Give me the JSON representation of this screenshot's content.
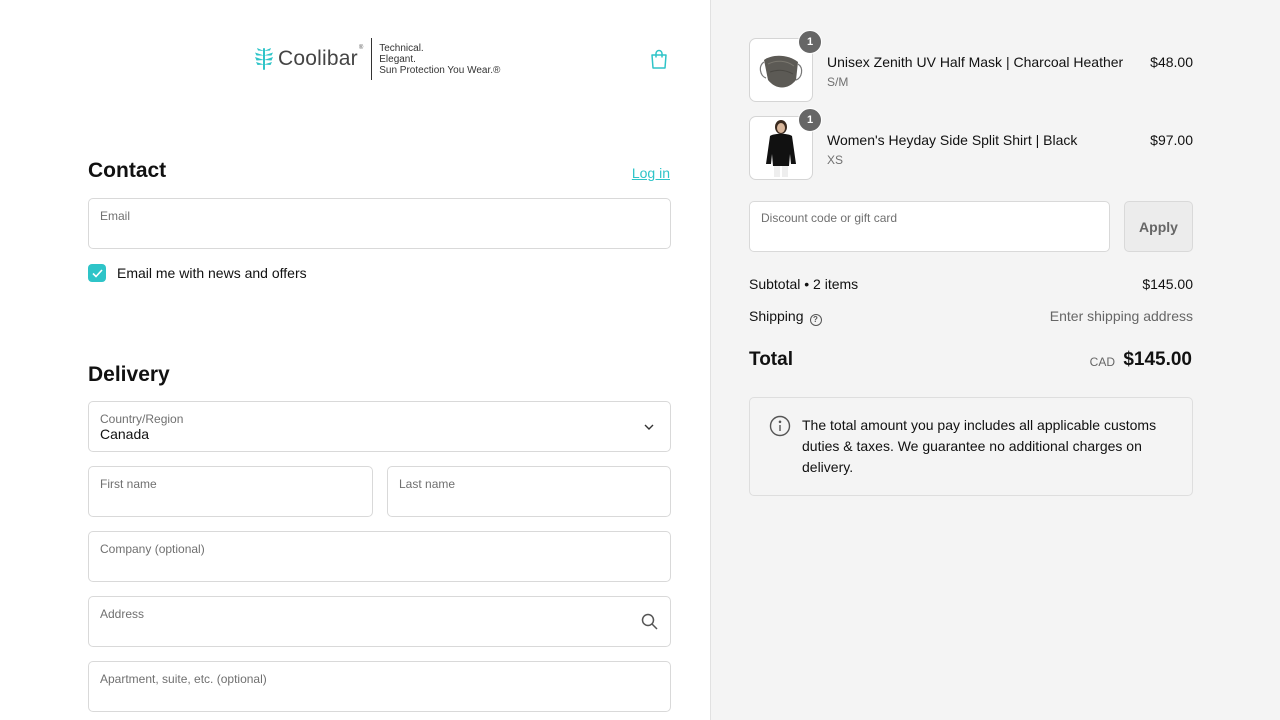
{
  "brand": {
    "name": "Coolibar",
    "reg_mark": "®",
    "tagline": [
      "Technical.",
      "Elegant.",
      "Sun Protection You Wear.®"
    ],
    "accent_color": "#2ec4c8"
  },
  "contact": {
    "heading": "Contact",
    "login_label": "Log in",
    "email": {
      "label": "Email",
      "value": ""
    },
    "newsletter": {
      "label": "Email me with news and offers",
      "checked": true
    }
  },
  "delivery": {
    "heading": "Delivery",
    "country": {
      "label": "Country/Region",
      "value": "Canada"
    },
    "first_name": {
      "label": "First name",
      "value": ""
    },
    "last_name": {
      "label": "Last name",
      "value": ""
    },
    "company": {
      "label": "Company (optional)",
      "value": ""
    },
    "address": {
      "label": "Address",
      "value": ""
    },
    "apartment": {
      "label": "Apartment, suite, etc. (optional)",
      "value": ""
    }
  },
  "cart": {
    "items": [
      {
        "name": "Unisex Zenith UV Half Mask | Charcoal Heather",
        "variant": "S/M",
        "price": "$48.00",
        "quantity": "1"
      },
      {
        "name": "Women's Heyday Side Split Shirt | Black",
        "variant": "XS",
        "price": "$97.00",
        "quantity": "1"
      }
    ],
    "discount": {
      "label": "Discount code or gift card",
      "value": ""
    },
    "apply_label": "Apply",
    "subtotal": {
      "label": "Subtotal • 2 items",
      "value": "$145.00"
    },
    "shipping": {
      "label": "Shipping",
      "value": "Enter shipping address"
    },
    "total": {
      "label": "Total",
      "currency": "CAD",
      "value": "$145.00"
    },
    "notice": "The total amount you pay includes all applicable customs duties & taxes. We guarantee no additional charges on delivery."
  }
}
